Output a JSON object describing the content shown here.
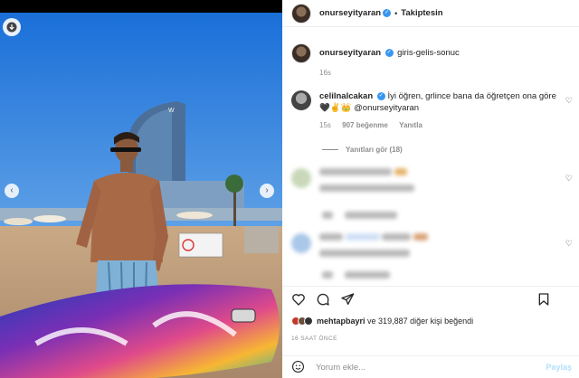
{
  "post": {
    "username": "onurseyityaran",
    "separator": "•",
    "follow_status": "Takiptesin"
  },
  "caption": {
    "username": "onurseyityaran",
    "text": "giris-gelis-sonuc",
    "time": "16s"
  },
  "comments": [
    {
      "username": "celilnalcakan",
      "text_line1": "İyi öğren, grlince bana da öğretçen ona göre",
      "emojis": "🖤✌️👑",
      "mention": "@onurseyityaran",
      "time": "15s",
      "likes": "907 beğenme",
      "reply": "Yanıtla",
      "view_replies": "Yanıtları gör (18)"
    }
  ],
  "likes": {
    "first_liker": "mehtapbayri",
    "rest": "ve 319,887 diğer kişi beğendi"
  },
  "posted_ago": "16 SAAT ÖNCE",
  "add_comment": {
    "placeholder": "Yorum ekle...",
    "post_label": "Paylaş"
  },
  "colors": {
    "verified": "#3897f0",
    "muted": "#8e8e8e",
    "post_disabled": "#b2dffc"
  },
  "icons": [
    "download-icon",
    "heart-icon",
    "comment-icon",
    "share-icon",
    "bookmark-icon",
    "emoji-icon",
    "chevron-left-icon",
    "chevron-right-icon"
  ]
}
